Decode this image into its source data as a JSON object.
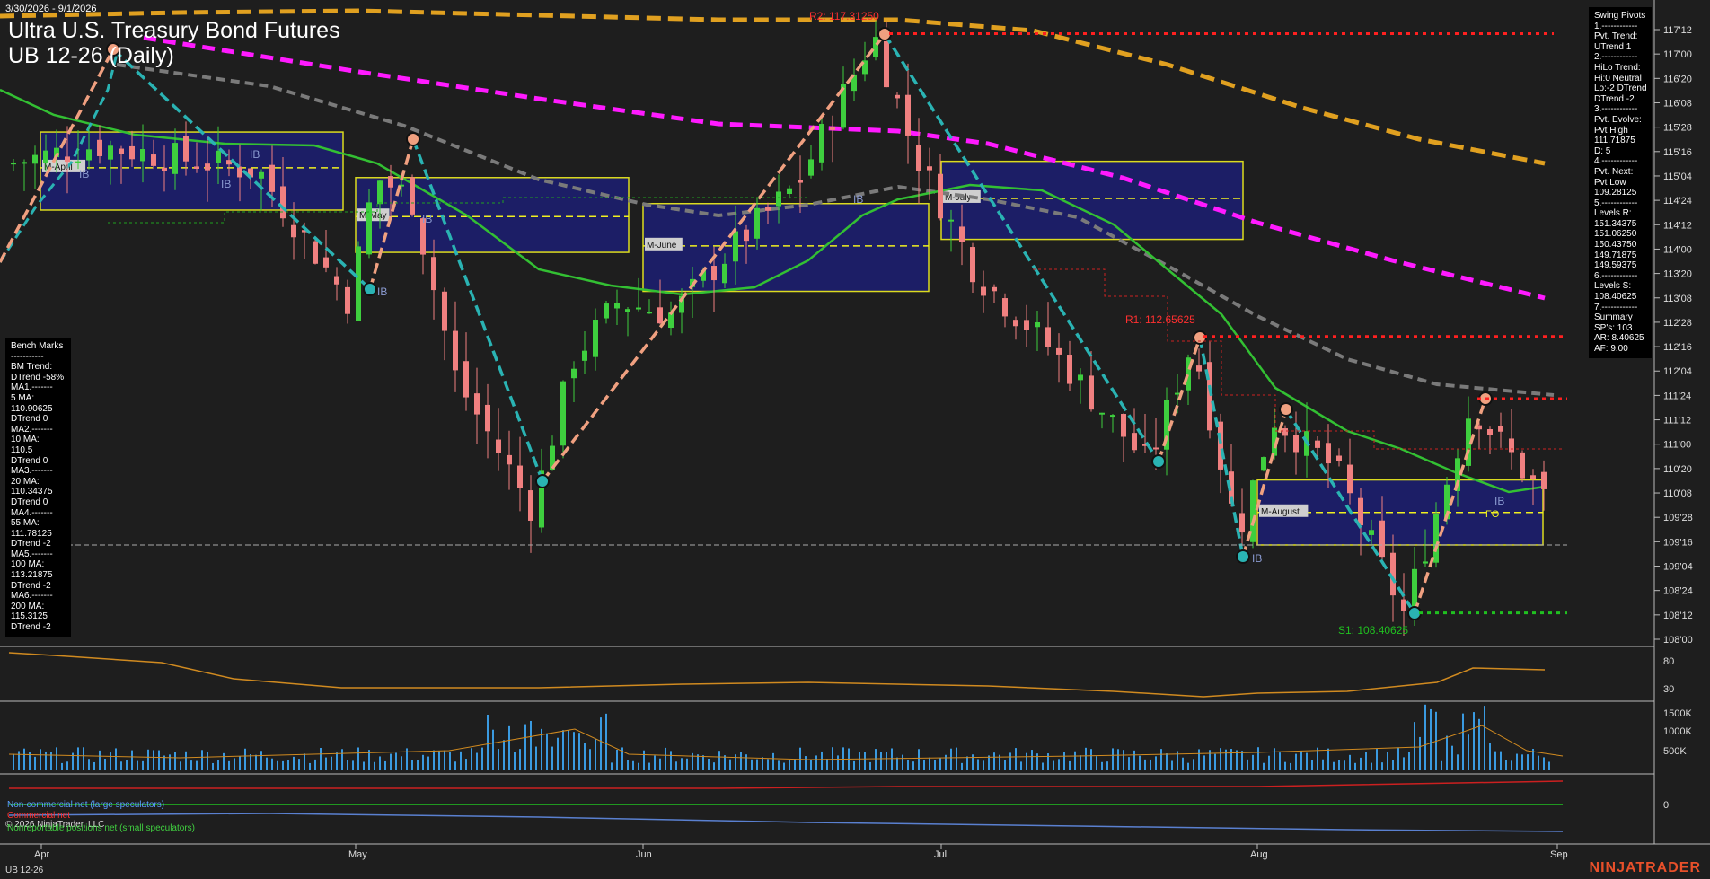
{
  "header": {
    "date_range": "3/30/2026 - 9/1/2026",
    "title_line1": "Ultra U.S. Treasury Bond Futures",
    "title_line2": "UB 12-26 (Daily)"
  },
  "swing_pivots": [
    "Swing Pivots",
    "1.------------",
    "Pvt. Trend:",
    "UTrend 1",
    "2.------------",
    "HiLo Trend:",
    "Hi:0 Neutral",
    "Lo:-2 DTrend",
    "DTrend -2",
    "3.------------",
    "Pvt. Evolve:",
    "Pvt High",
    "111.71875",
    "D: 5",
    "4.------------",
    "Pvt. Next:",
    "Pvt Low",
    "109.28125",
    "5.------------",
    "Levels R:",
    "151.34375",
    "151.06250",
    "150.43750",
    "149.71875",
    "149.59375",
    "6.------------",
    "Levels S:",
    "108.40625",
    "7.------------",
    "Summary",
    "SP's: 103",
    "AR: 8.40625",
    "AF: 9.00"
  ],
  "bench_marks": [
    "Bench Marks",
    "-----------",
    "BM Trend:",
    "DTrend -58%",
    "MA1.-------",
    "5 MA:",
    "110.90625",
    "DTrend 0",
    "MA2.-------",
    "10 MA:",
    "110.5",
    "DTrend 0",
    "MA3.-------",
    "20 MA:",
    "110.34375",
    "DTrend 0",
    "MA4.-------",
    "55 MA:",
    "111.78125",
    "DTrend -2",
    "MA5.-------",
    "100 MA:",
    "113.21875",
    "DTrend -2",
    "MA6.-------",
    "200 MA:",
    "115.3125",
    "DTrend -2"
  ],
  "bottom_legend": {
    "noncommercial": "Non-commercial net (large speculators)",
    "commercial": "Commercial net",
    "nonreportable": "Nonreportable positions net (small speculators)",
    "copyright": "© 2026 NinjaTrader, LLC"
  },
  "footer": {
    "symbol": "UB 12-26",
    "brand": "NINJATRADER"
  },
  "colors": {
    "background": "#1e1e1e",
    "up_candle": "#3ecf3e",
    "down_candle": "#f08080",
    "ma_green": "#33c033",
    "ma_gray": "#7a7a7a",
    "ma_magenta": "#ff1aff",
    "ma_orange": "#e0a020",
    "swing_up": "#2ab3b3",
    "swing_down": "#f0a080",
    "resistance": "#ff2020",
    "support": "#20c020",
    "box_fill": "#1c1f6e",
    "box_border": "#f0f020"
  },
  "chart_data": {
    "type": "candlestick",
    "price_axis_labels": [
      "117'12",
      "117'00",
      "116'20",
      "116'08",
      "115'28",
      "115'16",
      "115'04",
      "114'24",
      "114'12",
      "114'00",
      "113'20",
      "113'08",
      "112'28",
      "112'16",
      "112'04",
      "111'24",
      "111'12",
      "111'00",
      "110'20",
      "110'08",
      "109'28",
      "109'16",
      "109'04",
      "108'24",
      "108'12",
      "108'00"
    ],
    "price_range": [
      107.9,
      117.7
    ],
    "x_axis_labels": [
      "Apr",
      "May",
      "Jun",
      "Jul",
      "Aug",
      "Sep"
    ],
    "annotations": {
      "R2": {
        "text": "R2: 117.31250",
        "value": 117.3125
      },
      "R1": {
        "text": "R1: 112.65625",
        "value": 112.65625
      },
      "S1": {
        "text": "S1: 108.40625",
        "value": 108.40625
      }
    },
    "period_boxes": [
      {
        "label": "M-April",
        "high": 115.8,
        "low": 114.6,
        "mid": 115.25
      },
      {
        "label": "M-May",
        "high": 115.1,
        "low": 113.95,
        "mid": 114.5
      },
      {
        "label": "M-June",
        "high": 114.7,
        "low": 113.35,
        "mid": 114.05
      },
      {
        "label": "M-July",
        "high": 115.35,
        "low": 114.15,
        "mid": 114.78
      },
      {
        "label": "M-August",
        "high": 110.45,
        "low": 109.45,
        "mid": 109.95
      }
    ],
    "ib_labels": [
      "IB",
      "IB",
      "IB",
      "IB",
      "IB",
      "IB",
      "IB",
      "IB"
    ],
    "fo_label": "FO",
    "oscillator_axis_labels": [
      "80",
      "30"
    ],
    "volume_axis_labels": [
      "1500K",
      "1000K",
      "500K"
    ],
    "cot_axis_labels": [
      "0"
    ]
  }
}
